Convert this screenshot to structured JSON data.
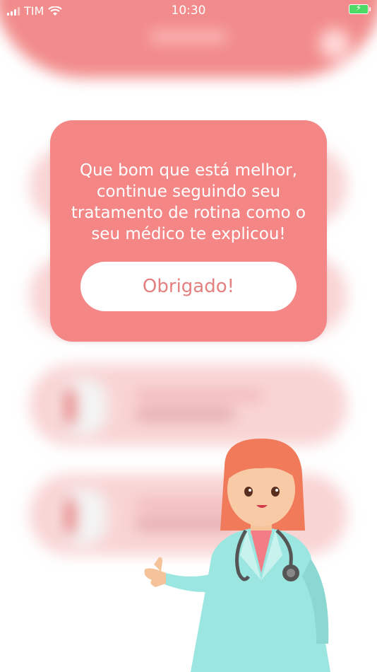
{
  "status_bar": {
    "carrier": "TIM",
    "time": "10:30"
  },
  "dialog": {
    "message": "Que bom que está melhor, continue seguindo seu tratamento de rotina como o seu médico te explicou!",
    "button_label": "Obrigado!"
  },
  "colors": {
    "accent": "#f48686",
    "button_text": "#e48080",
    "battery": "#4cd964"
  }
}
